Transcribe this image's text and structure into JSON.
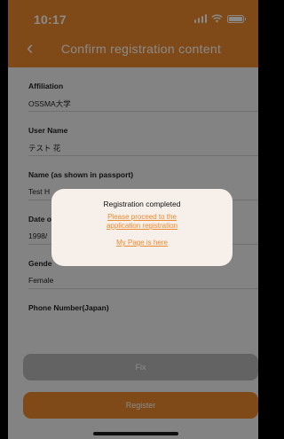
{
  "status_bar": {
    "time": "10:17"
  },
  "header": {
    "title": "Confirm registration content"
  },
  "form": {
    "fields": [
      {
        "label": "Affiliation",
        "value": "OSSMA大学"
      },
      {
        "label": "User Name",
        "value": "テスト 花"
      },
      {
        "label": "Name (as shown in passport)",
        "value": "Test H"
      },
      {
        "label": "Date o",
        "value": "1998/"
      },
      {
        "label": "Gende",
        "value": "Female"
      },
      {
        "label": "Phone Number(Japan)",
        "value": ""
      }
    ]
  },
  "buttons": {
    "fix": "Fix",
    "register": "Register"
  },
  "dialog": {
    "title": "Registration completed",
    "link_application_line1": "Please proceed to the",
    "link_application_line2": "application registration",
    "link_mypage": "My Page is here"
  },
  "colors": {
    "accent": "#eb8a2d",
    "disabled": "#b8b8b8"
  }
}
